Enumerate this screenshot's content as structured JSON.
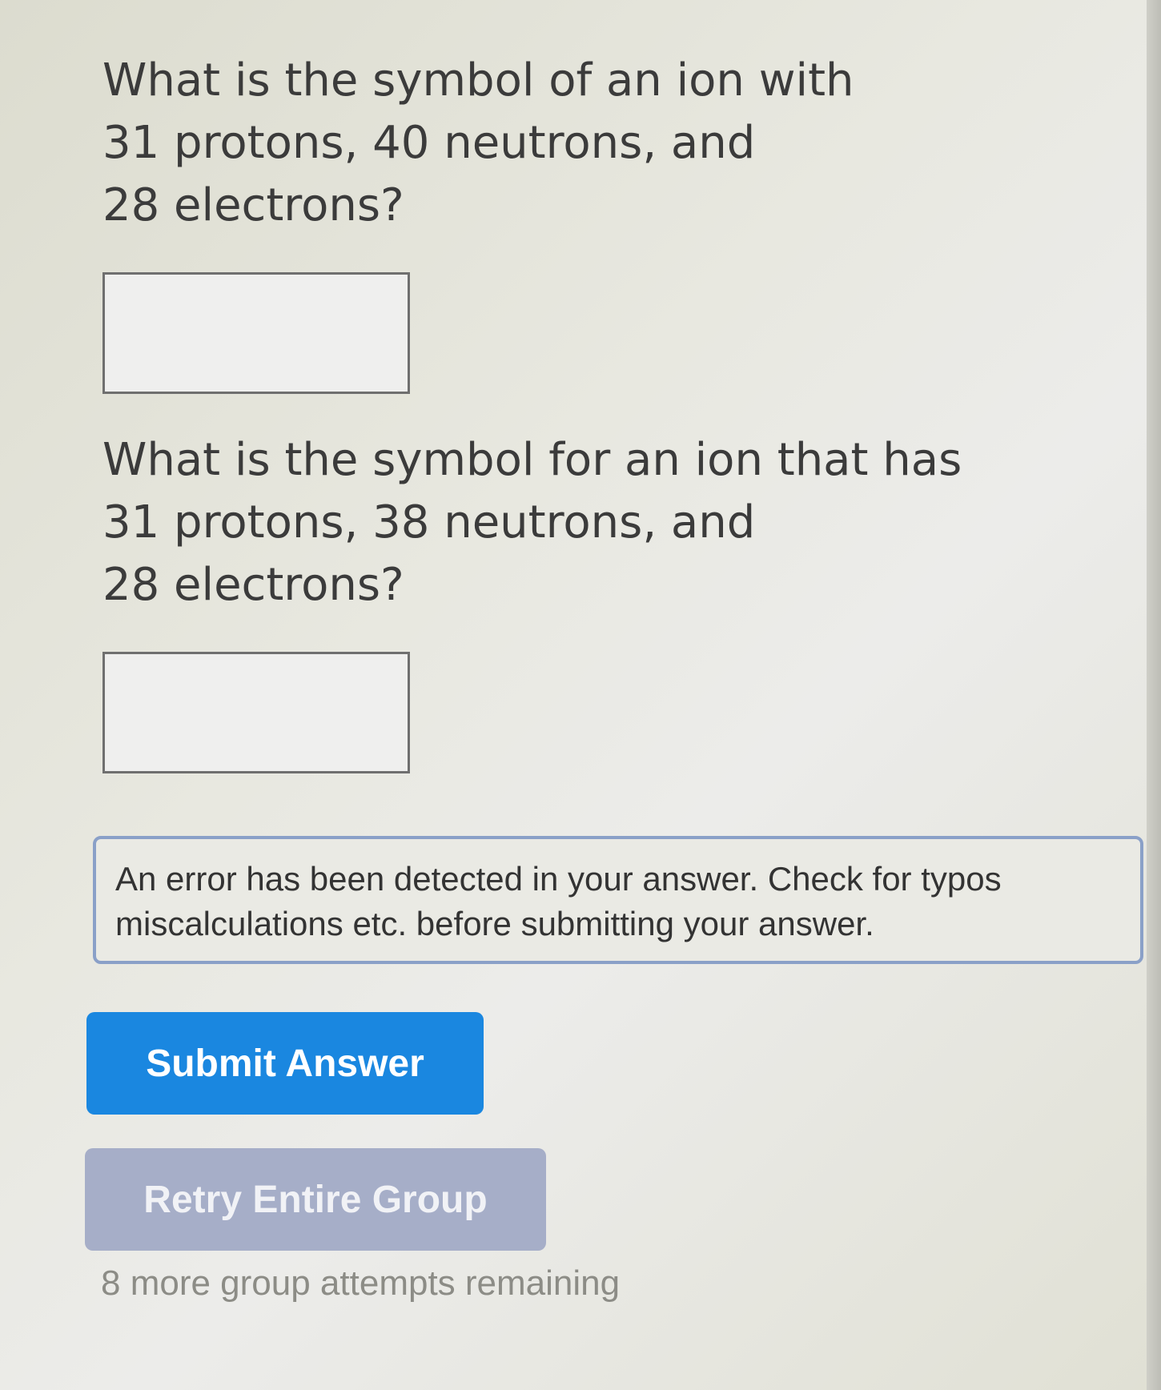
{
  "question1": {
    "text": "What is the symbol of an ion with\n31 protons, 40 neutrons, and\n28 electrons?",
    "answer_value": ""
  },
  "question2": {
    "text": "What is the symbol for an ion that has\n31 protons, 38 neutrons, and\n28 electrons?",
    "answer_value": ""
  },
  "error_message": "An error has been detected in your answer. Check for typos miscalculations etc. before submitting your answer.",
  "buttons": {
    "submit_label": "Submit Answer",
    "retry_label": "Retry Entire Group"
  },
  "attempts_text": "8 more group attempts remaining",
  "colors": {
    "submit_bg": "#1a87e0",
    "retry_bg": "#a6aec8",
    "error_border": "#8aa0c8"
  }
}
